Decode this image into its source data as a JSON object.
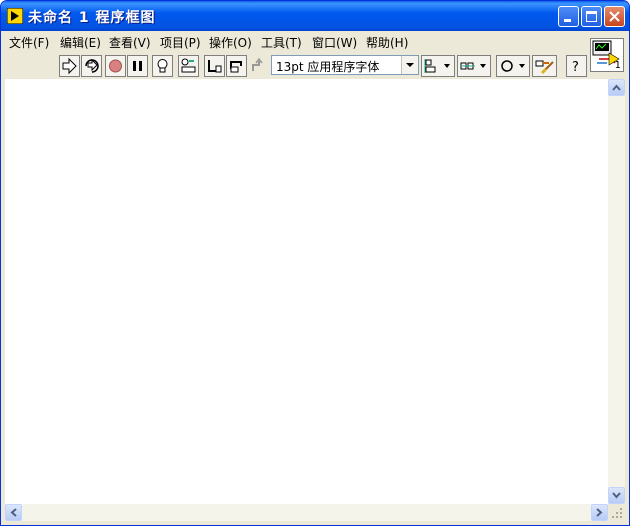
{
  "window": {
    "title": "未命名 1 程序框图",
    "accent": "#0058ee"
  },
  "menu": [
    {
      "label": "文件(F)"
    },
    {
      "label": "编辑(E)"
    },
    {
      "label": "查看(V)"
    },
    {
      "label": "项目(P)"
    },
    {
      "label": "操作(O)"
    },
    {
      "label": "工具(T)"
    },
    {
      "label": "窗口(W)"
    },
    {
      "label": "帮助(H)"
    }
  ],
  "toolbar": {
    "font_select": "13pt 应用程序字体",
    "icons": [
      "run-arrow-icon",
      "run-continuously-icon",
      "abort-icon",
      "pause-icon",
      "highlight-execution-icon",
      "retain-wire-values-icon",
      "step-into-icon",
      "step-over-icon",
      "step-out-icon",
      "align-objects-icon",
      "distribute-objects-icon",
      "reorder-icon",
      "clean-up-diagram-icon",
      "context-help-icon"
    ]
  },
  "vi_icon": {
    "number": "1"
  }
}
